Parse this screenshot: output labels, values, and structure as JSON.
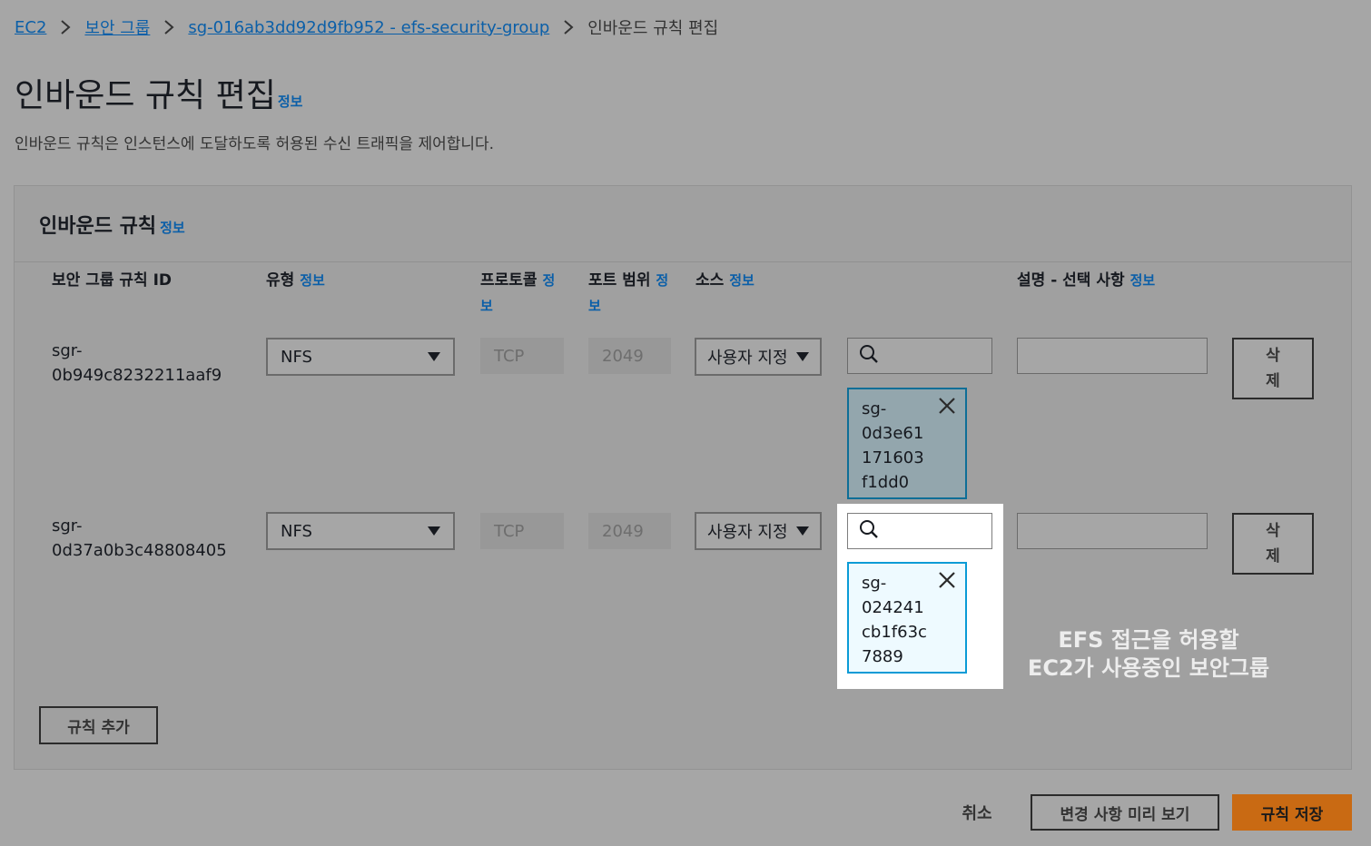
{
  "breadcrumb": {
    "items": [
      "EC2",
      "보안 그룹",
      "sg-016ab3dd92d9fb952 - efs-security-group"
    ],
    "current": "인바운드 규칙 편집"
  },
  "page": {
    "title": "인바운드 규칙 편집",
    "info": "정보",
    "description": "인바운드 규칙은 인스턴스에 도달하도록 허용된 수신 트래픽을 제어합니다."
  },
  "panel": {
    "title": "인바운드 규칙",
    "info": "정보",
    "columns": {
      "rule_id": "보안 그룹 규칙 ID",
      "type": "유형",
      "protocol_1": "프로토콜",
      "protocol_info_1": "정",
      "protocol_info_2": "보",
      "port_1": "포트 범위",
      "port_info_1": "정",
      "port_info_2": "보",
      "source": "소스",
      "description": "설명 - 선택 사항",
      "info": "정보"
    },
    "rows": [
      {
        "id_line1": "sgr-",
        "id_line2": "0b949c8232211aaf9",
        "type": "NFS",
        "protocol": "TCP",
        "port": "2049",
        "source_type": "사용자 지정",
        "token_lines": [
          "sg-",
          "0d3e61",
          "171603",
          "f1dd0"
        ],
        "description": "",
        "delete_line1": "삭",
        "delete_line2": "제"
      },
      {
        "id_line1": "sgr-",
        "id_line2": "0d37a0b3c48808405",
        "type": "NFS",
        "protocol": "TCP",
        "port": "2049",
        "source_type": "사용자 지정",
        "token_lines": [
          "sg-",
          "024241",
          "cb1f63c",
          "7889"
        ],
        "description": "",
        "delete_line1": "삭",
        "delete_line2": "제"
      }
    ],
    "add_rule": "규칙 추가"
  },
  "annotation": {
    "line1": "EFS 접근을 허용할",
    "line2": "EC2가 사용중인 보안그룹"
  },
  "footer": {
    "cancel": "취소",
    "preview": "변경 사항 미리 보기",
    "save": "규칙 저장"
  },
  "icons": {
    "search": "search-icon",
    "close": "close-icon",
    "caret": "caret-down-icon",
    "chevron": "chevron-right-icon"
  },
  "colors": {
    "link": "#0b5fa8",
    "primary_button": "#c96a13",
    "token_border": "#0a9bd6"
  }
}
